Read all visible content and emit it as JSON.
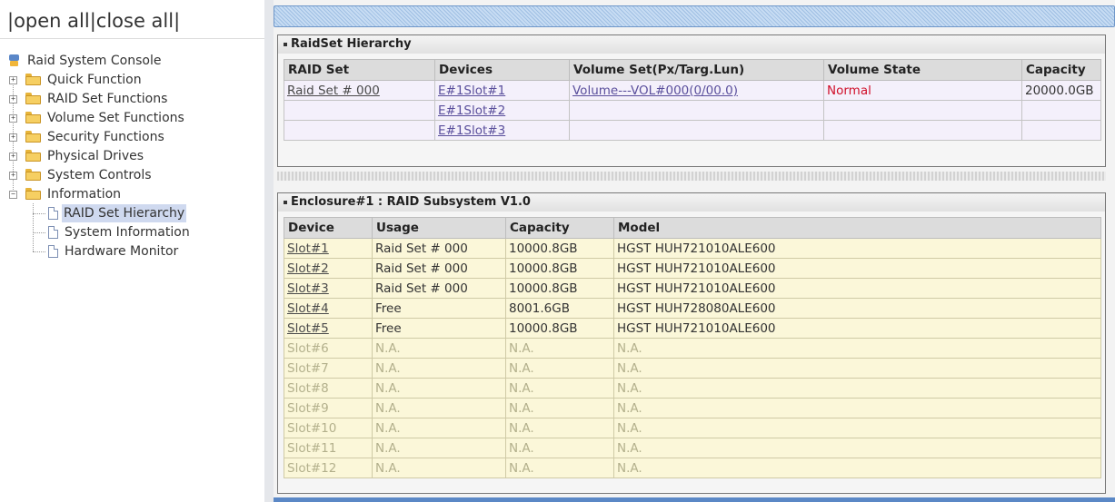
{
  "topbar": {
    "prefix": "|",
    "open_all": "open all",
    "mid": "|",
    "close_all": "close all",
    "suffix": "|"
  },
  "tree": {
    "root": "Raid System Console",
    "folders": [
      "Quick Function",
      "RAID Set Functions",
      "Volume Set Functions",
      "Security Functions",
      "Physical Drives",
      "System Controls",
      "Information"
    ],
    "info_children": [
      "RAID Set Hierarchy",
      "System Information",
      "Hardware Monitor"
    ],
    "selected": "RAID Set Hierarchy",
    "expand_symbol": "+",
    "collapse_symbol": "−"
  },
  "raidset": {
    "title": "RaidSet Hierarchy",
    "headers": [
      "RAID Set",
      "Devices",
      "Volume Set(Px/Targ.Lun)",
      "Volume State",
      "Capacity"
    ],
    "rows": [
      [
        "Raid Set # 000",
        "E#1Slot#1",
        "Volume---VOL#000(0/00.0)",
        "Normal",
        "20000.0GB"
      ],
      [
        "",
        "E#1Slot#2",
        "",
        "",
        ""
      ],
      [
        "",
        "E#1Slot#3",
        "",
        "",
        ""
      ]
    ]
  },
  "enclosure": {
    "title": "Enclosure#1 : RAID Subsystem V1.0",
    "headers": [
      "Device",
      "Usage",
      "Capacity",
      "Model"
    ],
    "rows": [
      [
        "Slot#1",
        "Raid Set # 000",
        "10000.8GB",
        "HGST HUH721010ALE600"
      ],
      [
        "Slot#2",
        "Raid Set # 000",
        "10000.8GB",
        "HGST HUH721010ALE600"
      ],
      [
        "Slot#3",
        "Raid Set # 000",
        "10000.8GB",
        "HGST HUH721010ALE600"
      ],
      [
        "Slot#4",
        "Free",
        "8001.6GB",
        "HGST HUH728080ALE600"
      ],
      [
        "Slot#5",
        "Free",
        "10000.8GB",
        "HGST HUH721010ALE600"
      ],
      [
        "Slot#6",
        "N.A.",
        "N.A.",
        "N.A."
      ],
      [
        "Slot#7",
        "N.A.",
        "N.A.",
        "N.A."
      ],
      [
        "Slot#8",
        "N.A.",
        "N.A.",
        "N.A."
      ],
      [
        "Slot#9",
        "N.A.",
        "N.A.",
        "N.A."
      ],
      [
        "Slot#10",
        "N.A.",
        "N.A.",
        "N.A."
      ],
      [
        "Slot#11",
        "N.A.",
        "N.A.",
        "N.A."
      ],
      [
        "Slot#12",
        "N.A.",
        "N.A.",
        "N.A."
      ]
    ]
  },
  "colors": {
    "normal_state": "#d0102a",
    "enclosure_row_bg": "#fbf7d9",
    "raidset_row_bg": "#f4f0fb",
    "na_text": "#b3b08c"
  }
}
